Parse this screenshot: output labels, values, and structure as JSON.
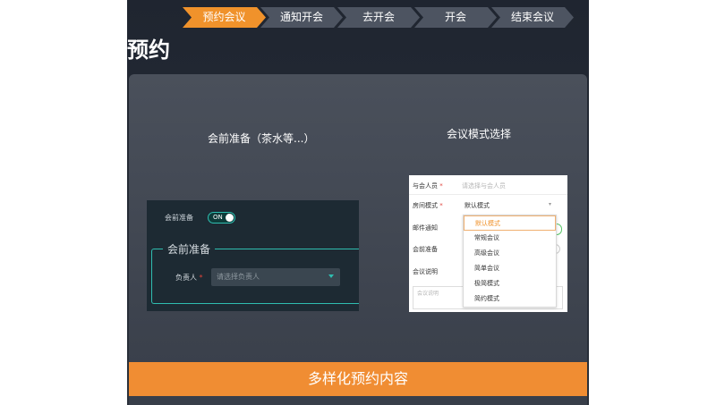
{
  "steps": [
    "预约会议",
    "通知开会",
    "去开会",
    "开会",
    "结束会议"
  ],
  "page_title": "预约",
  "left_caption": "会前准备（茶水等...）",
  "right_caption": "会议模式选择",
  "left_shot": {
    "toggle_label": "会前准备",
    "toggle_value": "ON",
    "section_title": "会前准备",
    "owner_label": "负责人",
    "required_mark": "*",
    "owner_placeholder": "请选择负责人"
  },
  "right_shot": {
    "attendees_label": "与会人员",
    "attendees_placeholder": "请选择与会人员",
    "mode_label": "房间模式",
    "mode_value": "默认模式",
    "email_label": "邮件通知",
    "prep_label": "会前准备",
    "desc_label": "会议说明",
    "desc_placeholder": "会议说明",
    "options": [
      "默认模式",
      "常规会议",
      "高级会议",
      "简单会议",
      "极简模式",
      "简约模式"
    ],
    "selected_option_index": 0
  },
  "bottom_bar": "多样化预约内容",
  "colors": {
    "accent": "#f0922b",
    "teal": "#2fbdb0",
    "dark_bg": "#1f2530"
  }
}
